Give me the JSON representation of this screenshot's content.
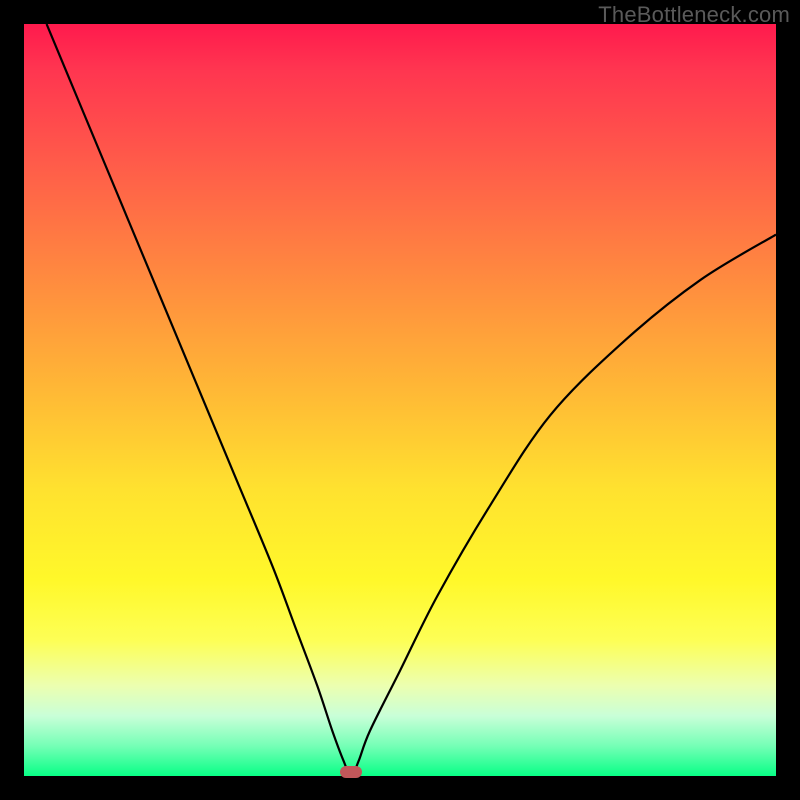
{
  "watermark": "TheBottleneck.com",
  "chart_data": {
    "type": "line",
    "title": "",
    "xlabel": "",
    "ylabel": "",
    "xlim": [
      0,
      100
    ],
    "ylim": [
      0,
      100
    ],
    "grid": false,
    "legend": false,
    "series": [
      {
        "name": "bottleneck-curve",
        "x": [
          3,
          8,
          13,
          18,
          23,
          28,
          33,
          36,
          39,
          41,
          42.5,
          43.5,
          44.5,
          46,
          50,
          55,
          62,
          70,
          80,
          90,
          100
        ],
        "y": [
          100,
          88,
          76,
          64,
          52,
          40,
          28,
          20,
          12,
          6,
          2,
          0,
          2,
          6,
          14,
          24,
          36,
          48,
          58,
          66,
          72
        ]
      }
    ],
    "marker": {
      "x": 43.5,
      "y": 0
    },
    "background_gradient": [
      "#ff1a4d",
      "#ffe22f",
      "#08ff86"
    ]
  }
}
